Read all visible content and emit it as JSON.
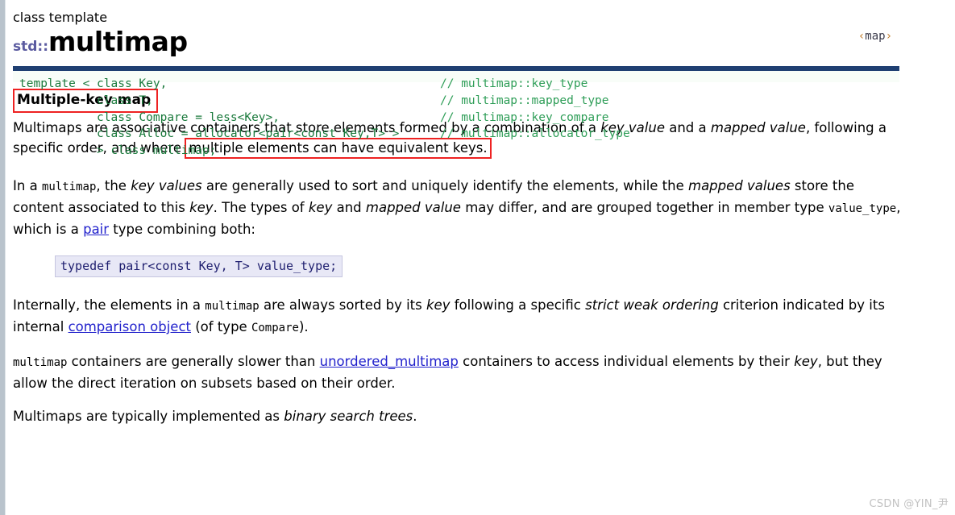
{
  "page": {
    "left_gutter_color": "#b9c3cc",
    "background": "#ffffff"
  },
  "header": {
    "kind": "class template",
    "namespace": "std::",
    "name": "multimap",
    "include_open": "‹",
    "include_name": "map",
    "include_close": "›",
    "include_full": "<map>",
    "accent_color": "#5b5ba0"
  },
  "declaration": {
    "top_bar_color": "#1f3f72",
    "background": "#f8fdf8",
    "code_color": "#1a7a3c",
    "left_lines": [
      "template < class Key,",
      "           class T,",
      "           class Compare = less<Key>,",
      "           class Alloc = allocator<pair<const Key,T> >",
      "           > class multimap;"
    ],
    "comment_lines": [
      "// multimap::key_type",
      "// multimap::mapped_type",
      "// multimap::key_compare",
      "// multimap::allocator_type"
    ]
  },
  "section": {
    "heading": "Multiple-key map",
    "annotation_color": "#ee2222"
  },
  "paragraphs": {
    "p1": {
      "a": "Multimaps are associative containers that store elements formed by a combination of a ",
      "b_em": "key value",
      "c": " and a ",
      "d_em": "mapped value",
      "e": ", following a specific order, and where ",
      "f_boxed": "multiple elements can have equivalent keys."
    },
    "p2": {
      "a": "In a ",
      "b_mono": "multimap",
      "c": ", the ",
      "d_em": "key values",
      "e": " are generally used to sort and uniquely identify the elements, while the ",
      "f_em": "mapped values",
      "g": " store the content associated to this ",
      "h_em": "key",
      "i": ". The types of ",
      "j_em": "key",
      "k": " and ",
      "l_em": "mapped value",
      "m": " may differ, and are grouped together in member type ",
      "n_mono": "value_type",
      "o": ", which is a ",
      "p_link": "pair",
      "q": " type combining both:"
    },
    "p3": {
      "a": "Internally, the elements in a ",
      "b_mono": "multimap",
      "c": " are always sorted by its ",
      "d_em": "key",
      "e": " following a specific ",
      "f_em": "strict weak ordering",
      "g": " criterion indicated by its internal ",
      "h_link": "comparison object",
      "i": " (of type ",
      "j_mono": "Compare",
      "k": ")."
    },
    "p4": {
      "a_mono": "multimap",
      "b": " containers are generally slower than ",
      "c_link": "unordered_multimap",
      "d": " containers to access individual elements by their ",
      "e_em": "key",
      "f": ", but they allow the direct iteration on subsets based on their order."
    },
    "p5": {
      "a": "Multimaps are typically implemented as ",
      "b_em": "binary search trees",
      "c": "."
    }
  },
  "typedef_snippet": {
    "keyword": "typedef",
    "type_open": "pair<",
    "const_kw": "const",
    "key": " Key,  T>",
    "alias": " value_type;",
    "full": "typedef pair<const Key,  T> value_type;",
    "background": "#e8e8f6"
  },
  "links": {
    "pair": "pair",
    "comparison_object": "comparison object",
    "unordered_multimap": "unordered_multimap",
    "color": "#2222cc"
  },
  "watermark": {
    "text": "CSDN @YIN_尹"
  }
}
